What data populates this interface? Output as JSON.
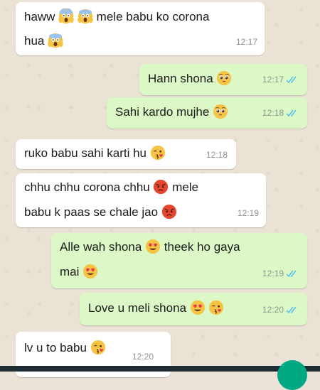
{
  "messages": [
    {
      "side": "in",
      "parts": [
        "haww",
        "😱",
        "😱",
        "mele babu ko corona"
      ],
      "line2": [
        "hua",
        "😱"
      ],
      "time": "12:17"
    },
    {
      "side": "out",
      "parts": [
        "Hann shona",
        "🥺"
      ],
      "time": "12:17"
    },
    {
      "side": "out",
      "parts": [
        "Sahi kardo mujhe",
        "🥺"
      ],
      "time": "12:18"
    },
    {
      "side": "in",
      "parts": [
        "ruko babu sahi karti hu",
        "😘"
      ],
      "time": "12:18"
    },
    {
      "side": "in",
      "parts": [
        "chhu chhu corona chhu",
        "😡",
        "mele"
      ],
      "line2": [
        "babu k paas se chale jao",
        "😡"
      ],
      "time": "12:19"
    },
    {
      "side": "out",
      "parts": [
        "Alle wah shona",
        "😍",
        "theek ho gaya"
      ],
      "line2": [
        "mai",
        "😍"
      ],
      "time": "12:19"
    },
    {
      "side": "out",
      "parts": [
        "Love u meli shona",
        "😍",
        "😘"
      ],
      "time": "12:20"
    },
    {
      "side": "in",
      "parts": [
        "lv u to babu",
        "😘"
      ],
      "time": "12:20"
    }
  ],
  "colors": {
    "incoming_bubble": "#ffffff",
    "outgoing_bubble": "#dcf8c6",
    "read_ticks": "#53bdeb",
    "timestamp": "#8c948e"
  },
  "icons": {
    "scream": "face-screaming-icon",
    "pleading": "pleading-face-icon",
    "kiss": "face-blowing-kiss-icon",
    "angry": "pouting-face-icon",
    "heart_eyes": "heart-eyes-face-icon",
    "read_receipt": "double-check-icon"
  }
}
